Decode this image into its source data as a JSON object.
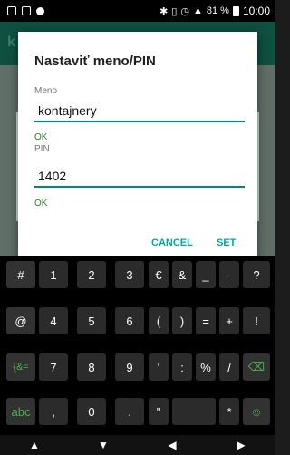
{
  "status_bar": {
    "battery": "81 %",
    "time": "10:00"
  },
  "dialog": {
    "title": "Nastaviť meno/PIN",
    "name_label": "Meno",
    "name_value": "kontajnery",
    "name_ok": "OK",
    "pin_label": "PIN",
    "pin_value": "1402",
    "pin_ok": "OK",
    "cancel": "CANCEL",
    "set": "SET"
  },
  "keyboard": {
    "row1": [
      "#",
      "1",
      "2",
      "3",
      "€",
      "&",
      "_",
      "-",
      "?"
    ],
    "row2": [
      "@",
      "4",
      "5",
      "6",
      "(",
      ")",
      "=",
      "+",
      "!"
    ],
    "row3": [
      "{&=",
      "7",
      "8",
      "9",
      "'",
      ":",
      "%",
      "/",
      "⌫"
    ],
    "row4": [
      "abc",
      ",",
      "0",
      ".",
      "\"",
      "",
      "*",
      "☺"
    ]
  },
  "colors": {
    "accent": "#00a99d",
    "ok": "#2e7d32",
    "app_bar": "#0f5041"
  }
}
